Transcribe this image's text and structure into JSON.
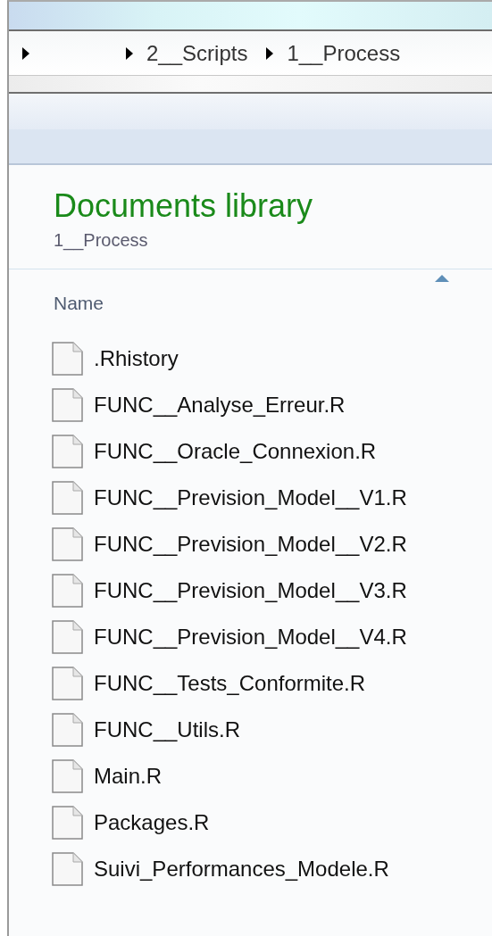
{
  "breadcrumb": [
    "2__Scripts",
    "1__Process"
  ],
  "library": {
    "title": "Documents library",
    "subtitle": "1__Process"
  },
  "column_header": {
    "label": "Name",
    "sorted_ascending": true
  },
  "files": [
    {
      "name": ".Rhistory"
    },
    {
      "name": "FUNC__Analyse_Erreur.R"
    },
    {
      "name": "FUNC__Oracle_Connexion.R"
    },
    {
      "name": "FUNC__Prevision_Model__V1.R"
    },
    {
      "name": "FUNC__Prevision_Model__V2.R"
    },
    {
      "name": "FUNC__Prevision_Model__V3.R"
    },
    {
      "name": "FUNC__Prevision_Model__V4.R"
    },
    {
      "name": "FUNC__Tests_Conformite.R"
    },
    {
      "name": "FUNC__Utils.R"
    },
    {
      "name": "Main.R"
    },
    {
      "name": "Packages.R"
    },
    {
      "name": "Suivi_Performances_Modele.R"
    }
  ]
}
